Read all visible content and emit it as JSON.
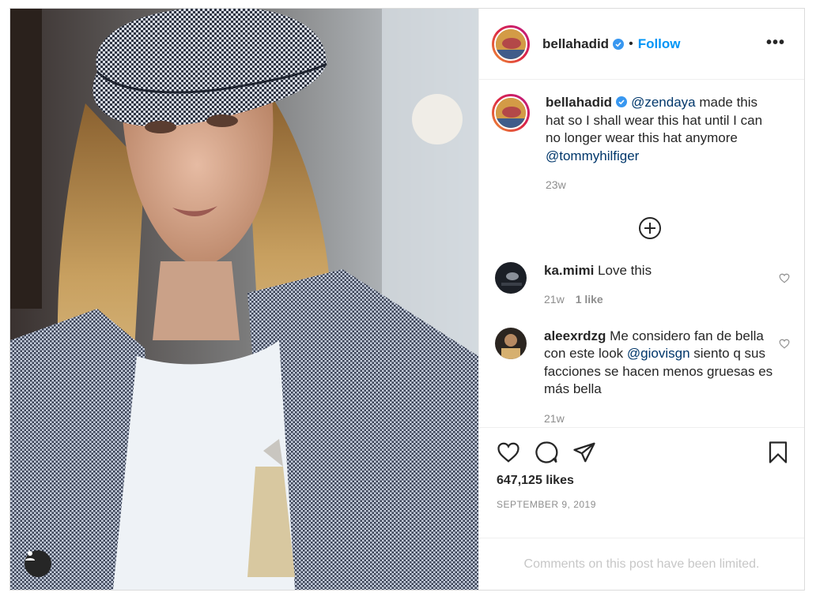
{
  "post": {
    "username": "bellahadid",
    "follow_label": "Follow",
    "separator": "•",
    "more_label": "•••"
  },
  "caption": {
    "username": "bellahadid",
    "mention1": "@zendaya",
    "text": " made this hat so I shall wear this hat until I can no longer wear this hat anymore ",
    "mention2": "@tommyhilfiger",
    "age": "23w"
  },
  "comments": [
    {
      "username": "ka.mimi",
      "text": "Love this",
      "age": "21w",
      "likes": "1 like"
    },
    {
      "username": "aleexrdzg",
      "text_before": "Me considero fan de bella con este look ",
      "mention": "@giovisgn",
      "text_after": " siento q sus facciones se hacen menos gruesas es más bella",
      "age": "21w"
    }
  ],
  "stats": {
    "likes": "647,125 likes",
    "date": "SEPTEMBER 9, 2019"
  },
  "footer": {
    "limited": "Comments on this post have been limited."
  },
  "icons": {
    "verified": "verified-badge-icon",
    "load_more": "plus-circle-icon",
    "like": "heart-icon",
    "comment": "comment-icon",
    "share": "paper-plane-icon",
    "save": "bookmark-icon",
    "tag": "user-tag-icon"
  },
  "colors": {
    "link": "#0095f6",
    "mention": "#00376b",
    "muted": "#8e8e8e",
    "verified": "#3897f0"
  }
}
